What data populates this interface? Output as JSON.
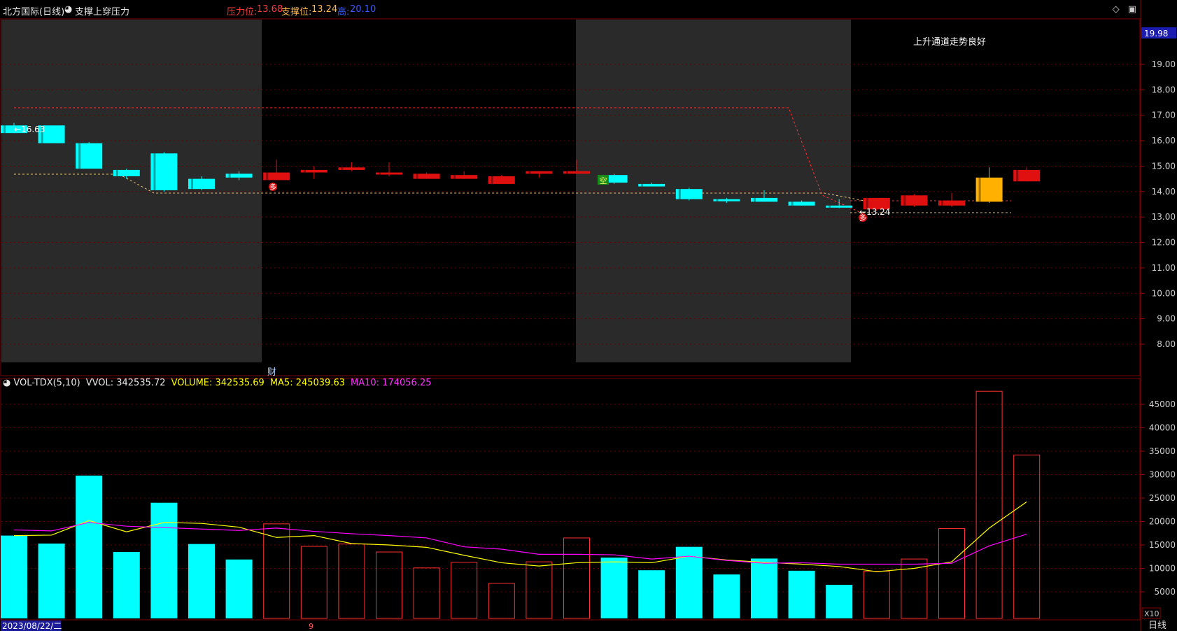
{
  "header": {
    "stock": "北方国际(日线)",
    "indicator_name": "支撑上穿压力",
    "pressure_label": "压力位:",
    "pressure_value": "13.68",
    "support_label": "支撑位:",
    "support_value": "13.24",
    "high_label": "高:",
    "high_value": "20.10"
  },
  "annotation": "上升通道走势良好",
  "price_axis": {
    "current": "19.98",
    "ticks": [
      "19.00",
      "18.00",
      "17.00",
      "16.00",
      "15.00",
      "14.00",
      "13.00",
      "12.00",
      "11.00",
      "10.00",
      "9.00",
      "8.00"
    ]
  },
  "labels": {
    "hi_price": "16.63",
    "lo_price": "13.24",
    "signal_a": "多",
    "signal_b": "空",
    "signal_c": "多",
    "finance_marker": "财",
    "bottom_marker": "9"
  },
  "volume_header": {
    "name": "VOL-TDX(5,10)",
    "vvol": "VVOL: 342535.72",
    "volume": "VOLUME: 342535.69",
    "ma5": "MA5: 245039.63",
    "ma10": "MA10: 174056.25"
  },
  "volume_axis": {
    "ticks": [
      "45000",
      "40000",
      "35000",
      "30000",
      "25000",
      "20000",
      "15000",
      "10000",
      "5000"
    ],
    "unit": "X10"
  },
  "footer": {
    "date": "2023/08/22/二",
    "period": "日线"
  },
  "colors": {
    "up": "#ff2a2a",
    "down": "#00ffff",
    "ma5": "#ffff00",
    "ma10": "#ff00ff",
    "grid": "#7a0000",
    "shade": "#2a2a2a"
  },
  "chart_data": {
    "type": "candlestick+volume",
    "candles": [
      {
        "o": 16.6,
        "h": 16.7,
        "l": 16.3,
        "c": 16.3,
        "dir": "down"
      },
      {
        "o": 16.6,
        "h": 16.6,
        "l": 15.9,
        "c": 15.9,
        "dir": "down"
      },
      {
        "o": 15.9,
        "h": 15.95,
        "l": 14.9,
        "c": 14.9,
        "dir": "down"
      },
      {
        "o": 14.85,
        "h": 14.9,
        "l": 14.5,
        "c": 14.6,
        "dir": "down"
      },
      {
        "o": 15.5,
        "h": 15.55,
        "l": 14.0,
        "c": 14.05,
        "dir": "down"
      },
      {
        "o": 14.5,
        "h": 14.6,
        "l": 14.05,
        "c": 14.1,
        "dir": "down"
      },
      {
        "o": 14.7,
        "h": 14.8,
        "l": 14.45,
        "c": 14.55,
        "dir": "down"
      },
      {
        "o": 14.45,
        "h": 15.25,
        "l": 14.45,
        "c": 14.75,
        "dir": "up"
      },
      {
        "o": 14.75,
        "h": 15.0,
        "l": 14.5,
        "c": 14.85,
        "dir": "up"
      },
      {
        "o": 14.85,
        "h": 15.15,
        "l": 14.8,
        "c": 14.95,
        "dir": "up"
      },
      {
        "o": 14.7,
        "h": 15.15,
        "l": 14.6,
        "c": 14.75,
        "dir": "up"
      },
      {
        "o": 14.5,
        "h": 14.75,
        "l": 14.5,
        "c": 14.7,
        "dir": "up"
      },
      {
        "o": 14.5,
        "h": 14.8,
        "l": 14.5,
        "c": 14.65,
        "dir": "up"
      },
      {
        "o": 14.3,
        "h": 14.65,
        "l": 14.3,
        "c": 14.6,
        "dir": "up"
      },
      {
        "o": 14.7,
        "h": 14.8,
        "l": 14.55,
        "c": 14.8,
        "dir": "up"
      },
      {
        "o": 14.7,
        "h": 15.25,
        "l": 14.7,
        "c": 14.8,
        "dir": "up"
      },
      {
        "o": 14.65,
        "h": 14.7,
        "l": 14.3,
        "c": 14.35,
        "dir": "down"
      },
      {
        "o": 14.3,
        "h": 14.35,
        "l": 14.2,
        "c": 14.2,
        "dir": "down"
      },
      {
        "o": 14.1,
        "h": 14.15,
        "l": 13.65,
        "c": 13.7,
        "dir": "down"
      },
      {
        "o": 13.7,
        "h": 13.75,
        "l": 13.55,
        "c": 13.65,
        "dir": "down"
      },
      {
        "o": 13.75,
        "h": 14.05,
        "l": 13.6,
        "c": 13.6,
        "dir": "down"
      },
      {
        "o": 13.6,
        "h": 13.65,
        "l": 13.45,
        "c": 13.45,
        "dir": "down"
      },
      {
        "o": 13.45,
        "h": 13.7,
        "l": 13.35,
        "c": 13.4,
        "dir": "down"
      },
      {
        "o": 13.3,
        "h": 13.75,
        "l": 13.24,
        "c": 13.75,
        "dir": "up"
      },
      {
        "o": 13.45,
        "h": 13.9,
        "l": 13.4,
        "c": 13.85,
        "dir": "up"
      },
      {
        "o": 13.45,
        "h": 13.95,
        "l": 13.4,
        "c": 13.65,
        "dir": "up"
      },
      {
        "o": 13.6,
        "h": 14.95,
        "l": 13.55,
        "c": 14.55,
        "dir": "up-highlight"
      },
      {
        "o": 14.4,
        "h": 14.95,
        "l": 14.4,
        "c": 14.85,
        "dir": "up"
      }
    ],
    "volume": [
      17000,
      15300,
      29800,
      13500,
      24000,
      15200,
      11900,
      19500,
      14700,
      15200,
      13500,
      10100,
      11300,
      6800,
      11400,
      16500,
      12300,
      9600,
      14600,
      8700,
      12100,
      9500,
      6500,
      9400,
      12000,
      18500,
      47800,
      34200
    ],
    "ma5": [
      17000,
      17100,
      20200,
      17800,
      19800,
      19600,
      18800,
      16600,
      17000,
      15300,
      15000,
      14500,
      12800,
      11200,
      10500,
      11200,
      11400,
      11200,
      12600,
      11800,
      11300,
      10900,
      10400,
      9300,
      10000,
      11400,
      18600,
      24200
    ],
    "ma10": [
      18200,
      18000,
      19800,
      19000,
      18700,
      18400,
      18100,
      18600,
      17900,
      17400,
      17000,
      16500,
      14600,
      14100,
      13000,
      13000,
      12900,
      12000,
      12600,
      11700,
      11100,
      11200,
      10900,
      10900,
      10900,
      11100,
      14800,
      17300
    ],
    "price_range": [
      7.5,
      20.0
    ],
    "volume_range": [
      0,
      50000
    ]
  }
}
